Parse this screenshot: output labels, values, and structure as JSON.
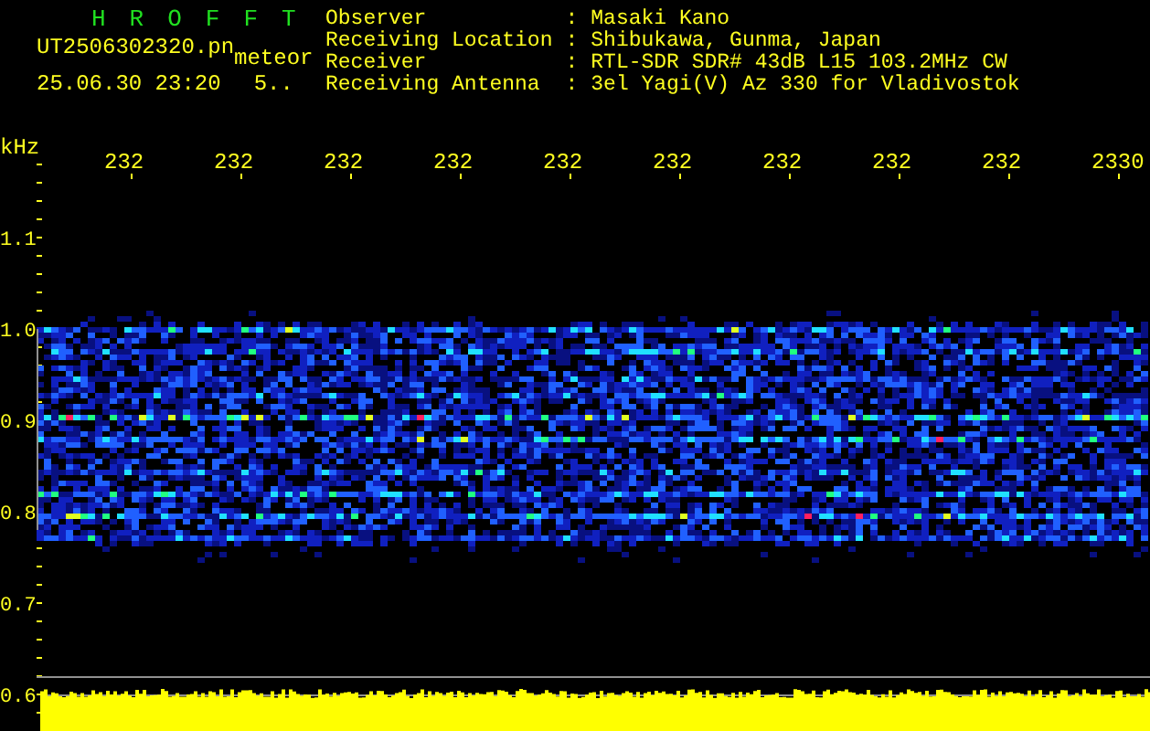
{
  "header": {
    "title": "HROFFT",
    "filename": "UT2506302320.pn",
    "tag": "meteor",
    "datetime": "25.06.30 23:20",
    "counter": "5.."
  },
  "station_info": [
    {
      "label": "Observer",
      "separator": ":",
      "value": "Masaki Kano"
    },
    {
      "label": "Receiving Location",
      "separator": ":",
      "value": "Shibukawa, Gunma, Japan"
    },
    {
      "label": "Receiver",
      "separator": ":",
      "value": "RTL-SDR SDR# 43dB L15 103.2MHz CW"
    },
    {
      "label": "Receiving Antenna",
      "separator": ":",
      "value": "3el Yagi(V) Az 330 for Vladivostok"
    }
  ],
  "time_axis": {
    "labels": [
      "232",
      "232",
      "232",
      "232",
      "232",
      "232",
      "232",
      "232",
      "232",
      "2330"
    ]
  },
  "freq_axis": {
    "unit": "kHz",
    "labels": [
      "1.1",
      "1.0",
      "0.9",
      "0.8",
      "0.7",
      "0.6"
    ]
  }
}
